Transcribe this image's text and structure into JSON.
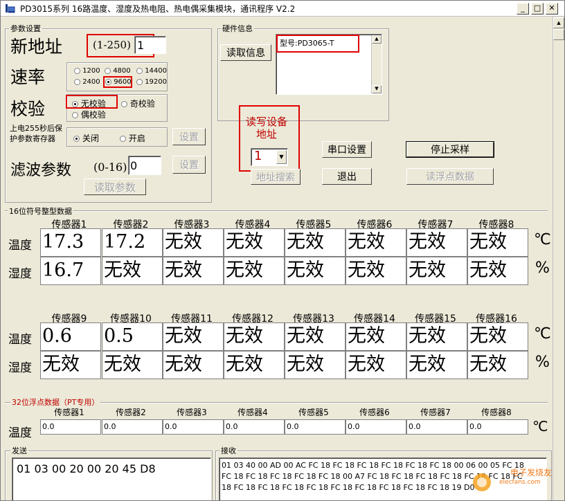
{
  "window": {
    "title": "PD3015系列 16路温度、湿度及热电阻、热电偶采集模块，通讯程序 V2.2"
  },
  "titlebar_buttons": {
    "minimize": "_",
    "maximize": "□",
    "close": "✕"
  },
  "params": {
    "group_label": "参数设置",
    "new_address_label": "新地址",
    "address_range": "(1-250)",
    "address_value": "1",
    "baud_label": "速率",
    "baud_options": [
      "1200",
      "4800",
      "14400",
      "2400",
      "9600",
      "19200"
    ],
    "baud_selected": "9600",
    "parity_label": "校验",
    "parity_options": [
      "无校验",
      "奇校验",
      "偶校验"
    ],
    "parity_selected": "无校验",
    "protect_label": "上电255秒后保护参数寄存器",
    "protect_options": [
      "关闭",
      "开启"
    ],
    "protect_selected": "关闭",
    "set_button": "设置",
    "filter_label": "滤波参数",
    "filter_range": "(0-16)",
    "filter_value": "0",
    "filter_set_button": "设置",
    "read_params_button": "读取参数"
  },
  "hardware": {
    "group_label": "硬件信息",
    "read_button": "读取信息",
    "info_text": "型号:PD3065-T"
  },
  "device_addr": {
    "label": "读写设备地址",
    "value": "1",
    "search_button": "地址搜索"
  },
  "buttons": {
    "serial": "串口设置",
    "exit": "退出",
    "stop": "停止采样",
    "read_float": "读浮点数据"
  },
  "int_section": {
    "label": "16位符号整型数据",
    "row_labels": [
      "温度",
      "湿度"
    ],
    "units": [
      "℃",
      "%"
    ],
    "headers1": [
      "传感器1",
      "传感器2",
      "传感器3",
      "传感器4",
      "传感器5",
      "传感器6",
      "传感器7",
      "传感器8"
    ],
    "temp1": [
      "17.3",
      "17.2",
      "无效",
      "无效",
      "无效",
      "无效",
      "无效",
      "无效"
    ],
    "hum1": [
      "16.7",
      "无效",
      "无效",
      "无效",
      "无效",
      "无效",
      "无效",
      "无效"
    ],
    "headers2": [
      "传感器9",
      "传感器10",
      "传感器11",
      "传感器12",
      "传感器13",
      "传感器14",
      "传感器15",
      "传感器16"
    ],
    "temp2": [
      "0.6",
      "0.5",
      "无效",
      "无效",
      "无效",
      "无效",
      "无效",
      "无效"
    ],
    "hum2": [
      "无效",
      "无效",
      "无效",
      "无效",
      "无效",
      "无效",
      "无效",
      "无效"
    ]
  },
  "float_section": {
    "label": "32位浮点数据（PT专用）",
    "row_label": "温度",
    "unit": "℃",
    "headers": [
      "传感器1",
      "传感器2",
      "传感器3",
      "传感器4",
      "传感器5",
      "传感器6",
      "传感器7",
      "传感器8"
    ],
    "values": [
      "0.0",
      "0.0",
      "0.0",
      "0.0",
      "0.0",
      "0.0",
      "0.0",
      "0.0"
    ]
  },
  "send": {
    "label": "发送",
    "text": "01 03 00 20 00 20 45 D8"
  },
  "receive": {
    "label": "接收",
    "lines": [
      "01 03 40 00 AD 00 AC FC 18 FC 18 FC 18 FC 18 FC 18 FC 18 00 06 00 05 FC 18",
      "FC 18 FC 18 FC 18 FC 18 FC 18 00 A7 FC 18 FC 18 FC 18 FC 18 FC 18 FC 18 FC",
      "18 FC 18 FC 18 FC 18 FC 18 FC 18 FC 18 FC 18 FC 18 FC 18 19 D0"
    ]
  },
  "watermark": {
    "text": "电子发烧友",
    "url_text": "elecfans.com"
  }
}
